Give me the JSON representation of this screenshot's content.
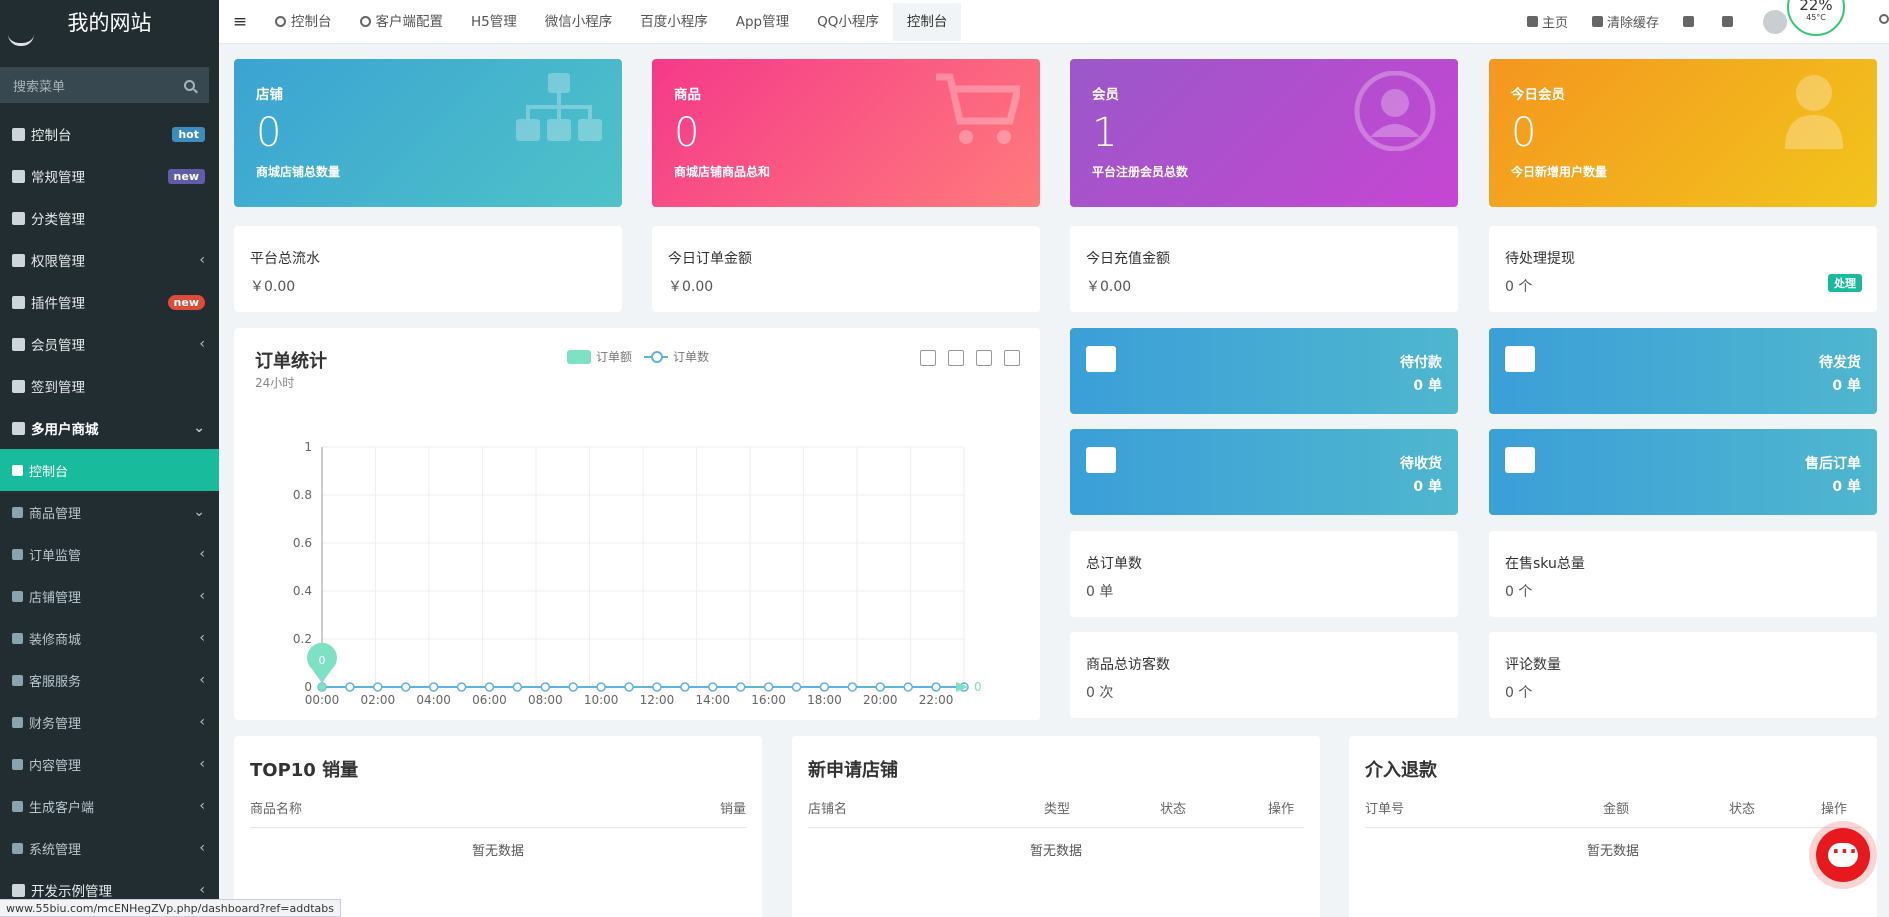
{
  "brand": "我的网站",
  "search": {
    "placeholder": "搜索菜单"
  },
  "sidebar": {
    "items": [
      {
        "label": "控制台",
        "badge": "hot"
      },
      {
        "label": "常规管理",
        "badge": "new"
      },
      {
        "label": "分类管理"
      },
      {
        "label": "权限管理"
      },
      {
        "label": "插件管理",
        "badge": "new"
      },
      {
        "label": "会员管理"
      },
      {
        "label": "签到管理"
      },
      {
        "label": "多用户商城"
      },
      {
        "label": "控制台"
      },
      {
        "label": "商品管理"
      },
      {
        "label": "订单监管"
      },
      {
        "label": "店铺管理"
      },
      {
        "label": "装修商城"
      },
      {
        "label": "客服服务"
      },
      {
        "label": "财务管理"
      },
      {
        "label": "内容管理"
      },
      {
        "label": "生成客户端"
      },
      {
        "label": "系统管理"
      },
      {
        "label": "开发示例管理"
      }
    ]
  },
  "topbar": {
    "tabs": [
      "控制台",
      "客户端配置",
      "H5管理",
      "微信小程序",
      "百度小程序",
      "App管理",
      "QQ小程序",
      "控制台"
    ],
    "home": "主页",
    "clear_cache": "清除缓存",
    "gauge_pct": "22%",
    "gauge_temp": "45°C"
  },
  "cards": [
    {
      "title": "店铺",
      "value": "0",
      "desc": "商城店铺总数量"
    },
    {
      "title": "商品",
      "value": "0",
      "desc": "商城店铺商品总和"
    },
    {
      "title": "会员",
      "value": "1",
      "desc": "平台注册会员总数"
    },
    {
      "title": "今日会员",
      "value": "0",
      "desc": "今日新增用户数量"
    }
  ],
  "stats": [
    {
      "label": "平台总流水",
      "value": "￥0.00"
    },
    {
      "label": "今日订单金额",
      "value": "￥0.00"
    },
    {
      "label": "今日充值金额",
      "value": "￥0.00"
    },
    {
      "label": "待处理提现",
      "value": "0 个",
      "badge": "处理"
    }
  ],
  "chart": {
    "title": "订单统计",
    "subtitle": "24小时",
    "legend_amount": "订单额",
    "legend_count": "订单数",
    "marker": "0",
    "end_label": "0"
  },
  "chart_data": {
    "type": "line",
    "title": "订单统计",
    "subtitle": "24小时",
    "x": [
      "00:00",
      "01:00",
      "02:00",
      "03:00",
      "04:00",
      "05:00",
      "06:00",
      "07:00",
      "08:00",
      "09:00",
      "10:00",
      "11:00",
      "12:00",
      "13:00",
      "14:00",
      "15:00",
      "16:00",
      "17:00",
      "18:00",
      "19:00",
      "20:00",
      "21:00",
      "22:00",
      "23:00"
    ],
    "x_tick_labels": [
      "00:00",
      "02:00",
      "04:00",
      "06:00",
      "08:00",
      "10:00",
      "12:00",
      "14:00",
      "16:00",
      "18:00",
      "20:00",
      "22:00"
    ],
    "y_tick_labels": [
      "0",
      "0.2",
      "0.4",
      "0.6",
      "0.8",
      "1"
    ],
    "ylim": [
      0,
      1
    ],
    "grid": true,
    "legend_position": "top-center",
    "series": [
      {
        "name": "订单额",
        "values": [
          0,
          0,
          0,
          0,
          0,
          0,
          0,
          0,
          0,
          0,
          0,
          0,
          0,
          0,
          0,
          0,
          0,
          0,
          0,
          0,
          0,
          0,
          0,
          0
        ],
        "color": "#7de2c4"
      },
      {
        "name": "订单数",
        "values": [
          0,
          0,
          0,
          0,
          0,
          0,
          0,
          0,
          0,
          0,
          0,
          0,
          0,
          0,
          0,
          0,
          0,
          0,
          0,
          0,
          0,
          0,
          0,
          0
        ],
        "color": "#5fb5df"
      }
    ]
  },
  "tiles": [
    {
      "label": "待付款",
      "value": "0 单",
      "icon": "coffee-icon"
    },
    {
      "label": "待发货",
      "value": "0 单",
      "icon": "truck-icon"
    },
    {
      "label": "待收货",
      "value": "0 单",
      "icon": "cube-icon"
    },
    {
      "label": "售后订单",
      "value": "0 单",
      "icon": "cart-icon"
    }
  ],
  "stats2": [
    {
      "label": "总订单数",
      "value": "0 单"
    },
    {
      "label": "在售sku总量",
      "value": "0 个"
    },
    {
      "label": "商品总访客数",
      "value": "0 次"
    },
    {
      "label": "评论数量",
      "value": "0 个"
    }
  ],
  "tables": [
    {
      "title": "TOP10 销量",
      "cols": [
        "商品名称",
        "销量"
      ],
      "empty": "暂无数据"
    },
    {
      "title": "新申请店铺",
      "cols": [
        "店铺名",
        "类型",
        "状态",
        "操作"
      ],
      "empty": "暂无数据"
    },
    {
      "title": "介入退款",
      "cols": [
        "订单号",
        "金额",
        "状态",
        "操作"
      ],
      "empty": "暂无数据"
    }
  ],
  "status_url": "www.55biu.com/mcENHegZVp.php/dashboard?ref=addtabs"
}
